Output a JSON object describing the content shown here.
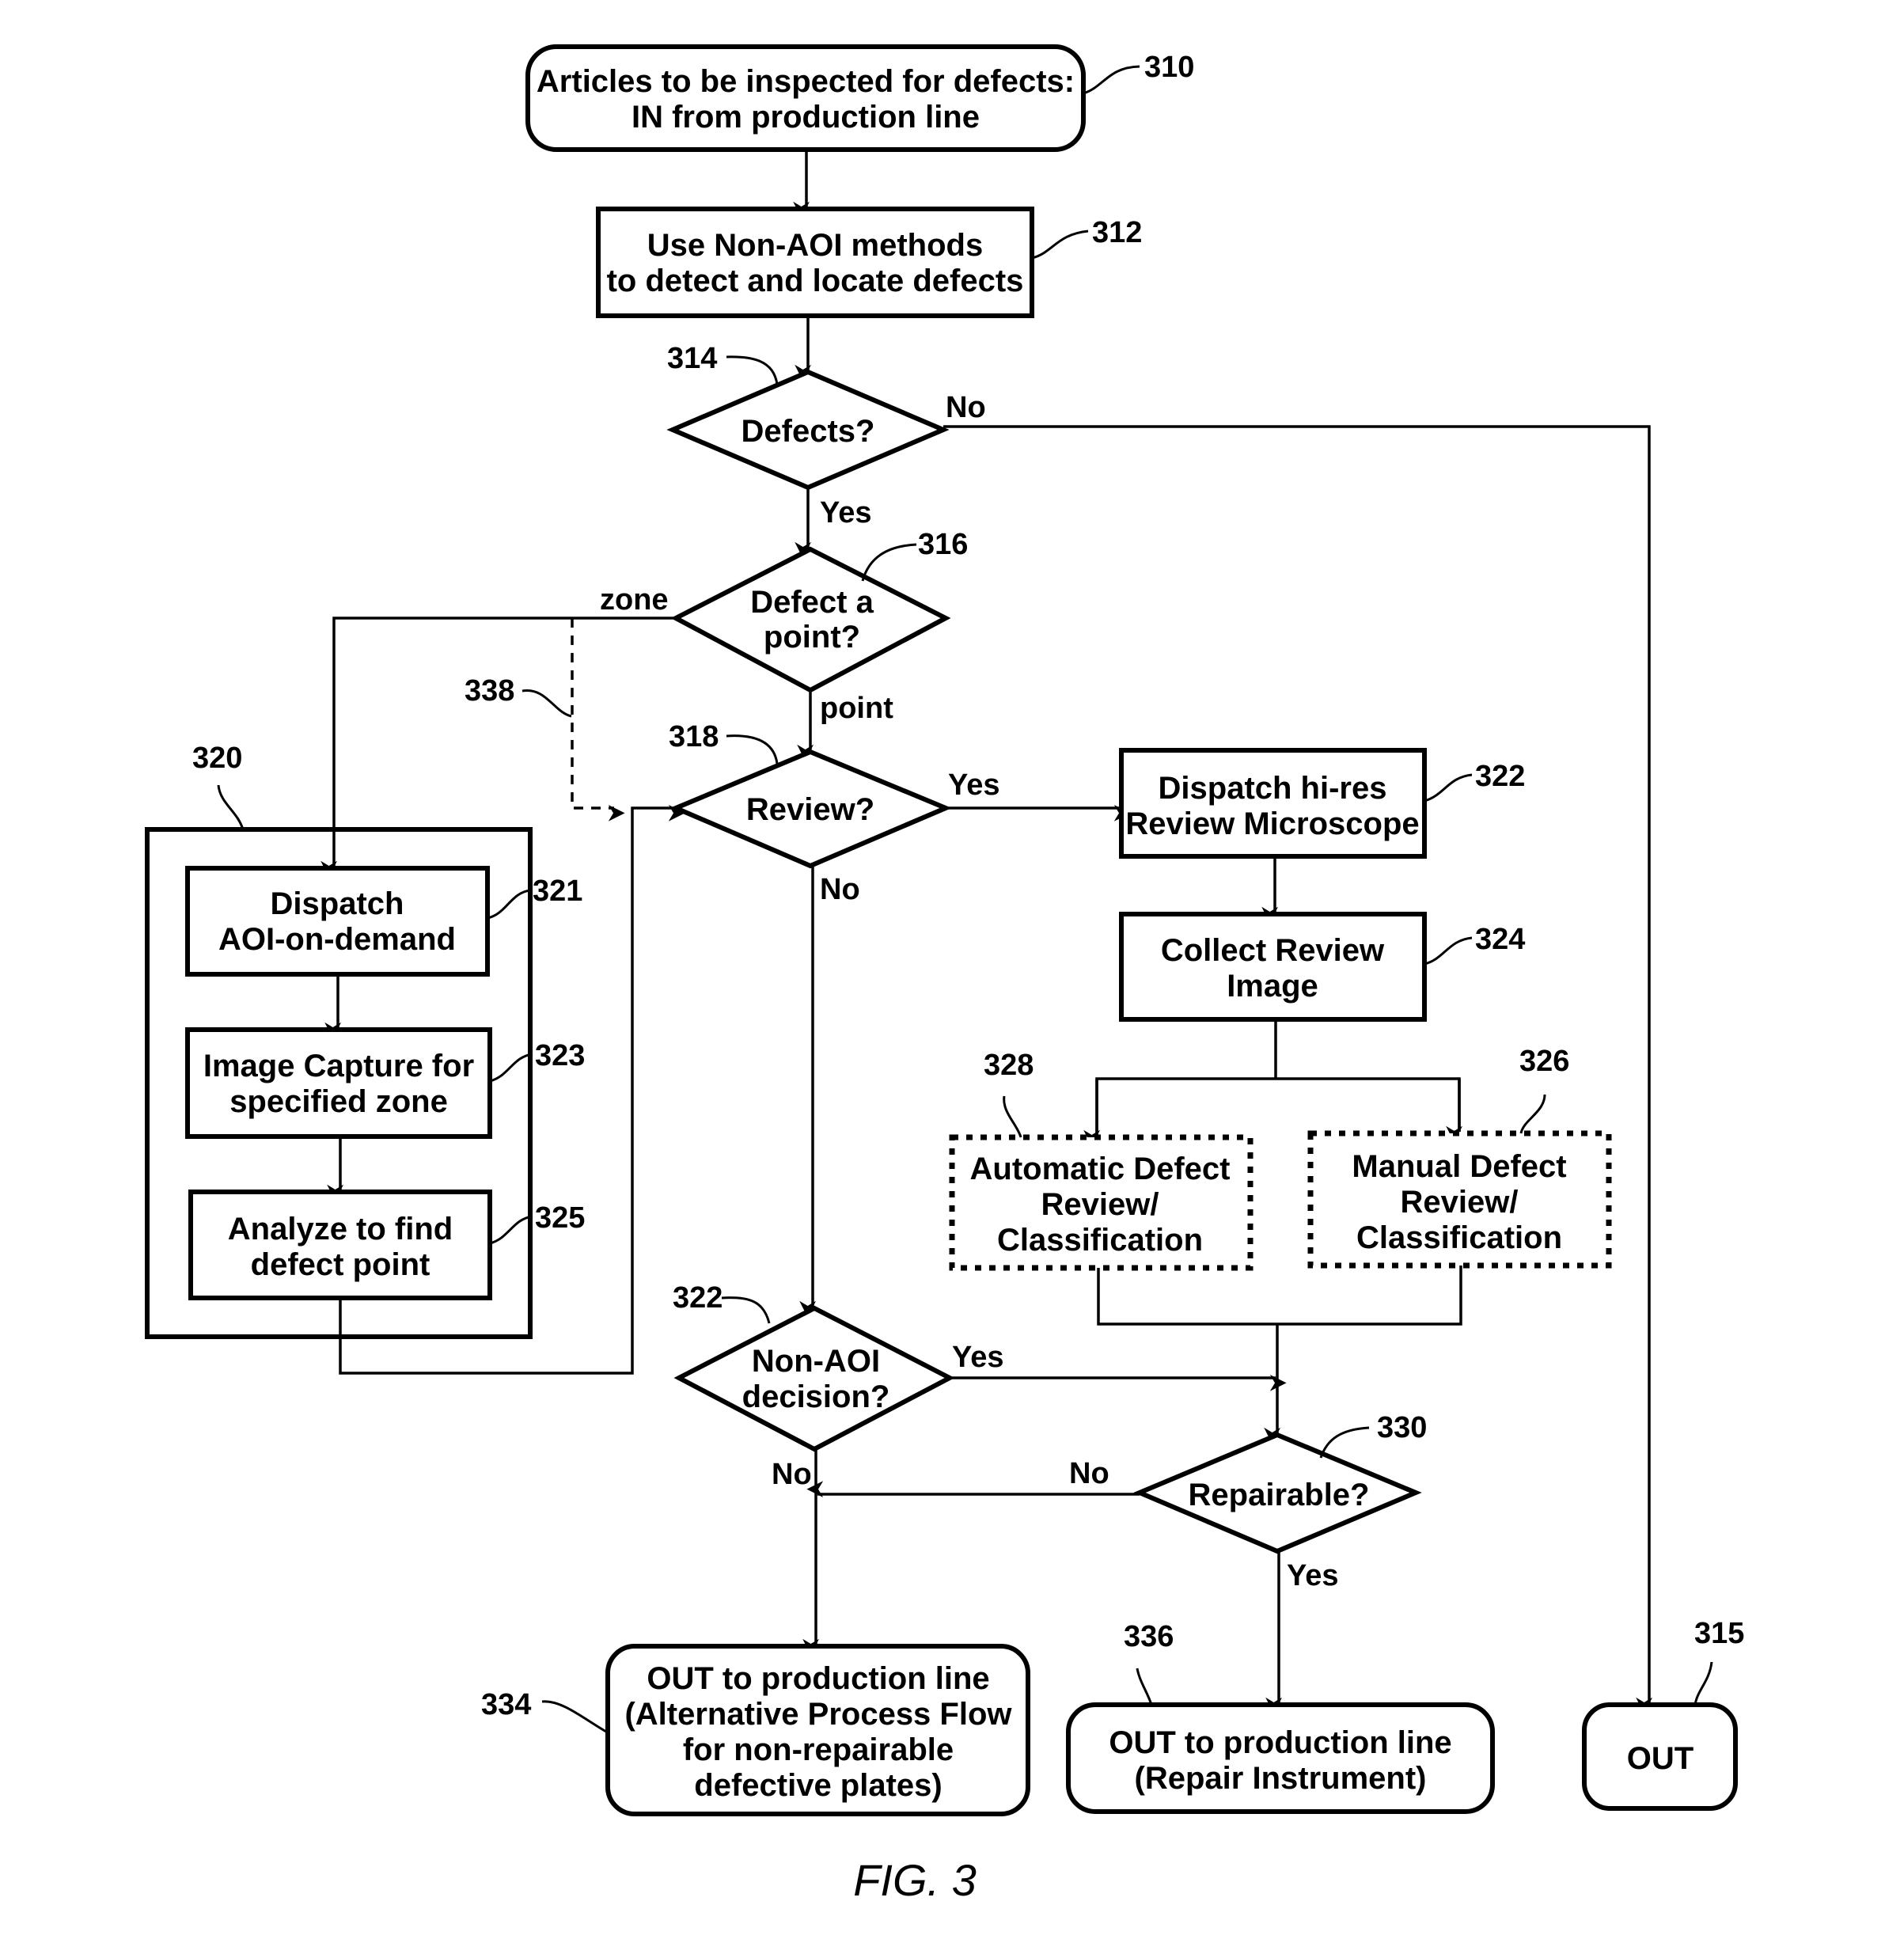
{
  "figure": {
    "caption": "FIG. 3"
  },
  "nodes": {
    "start": {
      "ref": "310",
      "lines": [
        "Articles to be inspected for defects:",
        "IN from production line"
      ]
    },
    "non_aoi_methods": {
      "ref": "312",
      "lines": [
        "Use Non-AOI methods",
        "to detect and locate defects"
      ]
    },
    "defects_decision": {
      "ref": "314",
      "lines": [
        "Defects?"
      ]
    },
    "point_decision": {
      "ref": "316",
      "lines": [
        "Defect a",
        "point?"
      ]
    },
    "review_decision": {
      "ref": "318",
      "lines": [
        "Review?"
      ]
    },
    "aoi_group": {
      "ref": "320"
    },
    "dispatch_aoi": {
      "ref": "321",
      "lines": [
        "Dispatch",
        "AOI-on-demand"
      ]
    },
    "image_capture": {
      "ref": "323",
      "lines": [
        "Image Capture for",
        "specified zone"
      ]
    },
    "analyze": {
      "ref": "325",
      "lines": [
        "Analyze to find",
        "defect point"
      ]
    },
    "dispatch_microscope": {
      "ref": "322",
      "lines": [
        "Dispatch hi-res",
        "Review Microscope"
      ]
    },
    "collect_image": {
      "ref": "324",
      "lines": [
        "Collect Review",
        "Image"
      ]
    },
    "auto_review": {
      "ref": "328",
      "lines": [
        "Automatic Defect",
        "Review/",
        "Classification"
      ]
    },
    "manual_review": {
      "ref": "326",
      "lines": [
        "Manual Defect",
        "Review/",
        "Classification"
      ]
    },
    "non_aoi_decision": {
      "ref": "322",
      "lines": [
        "Non-AOI",
        "decision?"
      ]
    },
    "repairable_decision": {
      "ref": "330",
      "lines": [
        "Repairable?"
      ]
    },
    "out_alternative": {
      "ref": "334",
      "lines": [
        "OUT to production line",
        "(Alternative Process Flow",
        "for non-repairable",
        "defective plates)"
      ]
    },
    "out_repair": {
      "ref": "336",
      "lines": [
        "OUT to production line",
        "(Repair Instrument)"
      ]
    },
    "out": {
      "ref": "315",
      "lines": [
        "OUT"
      ]
    },
    "bypass_path": {
      "ref": "338"
    }
  },
  "edge_labels": {
    "defects_no": "No",
    "defects_yes": "Yes",
    "zone": "zone",
    "point": "point",
    "review_yes": "Yes",
    "review_no": "No",
    "non_aoi_yes": "Yes",
    "non_aoi_no": "No",
    "repairable_no": "No",
    "repairable_yes": "Yes"
  }
}
